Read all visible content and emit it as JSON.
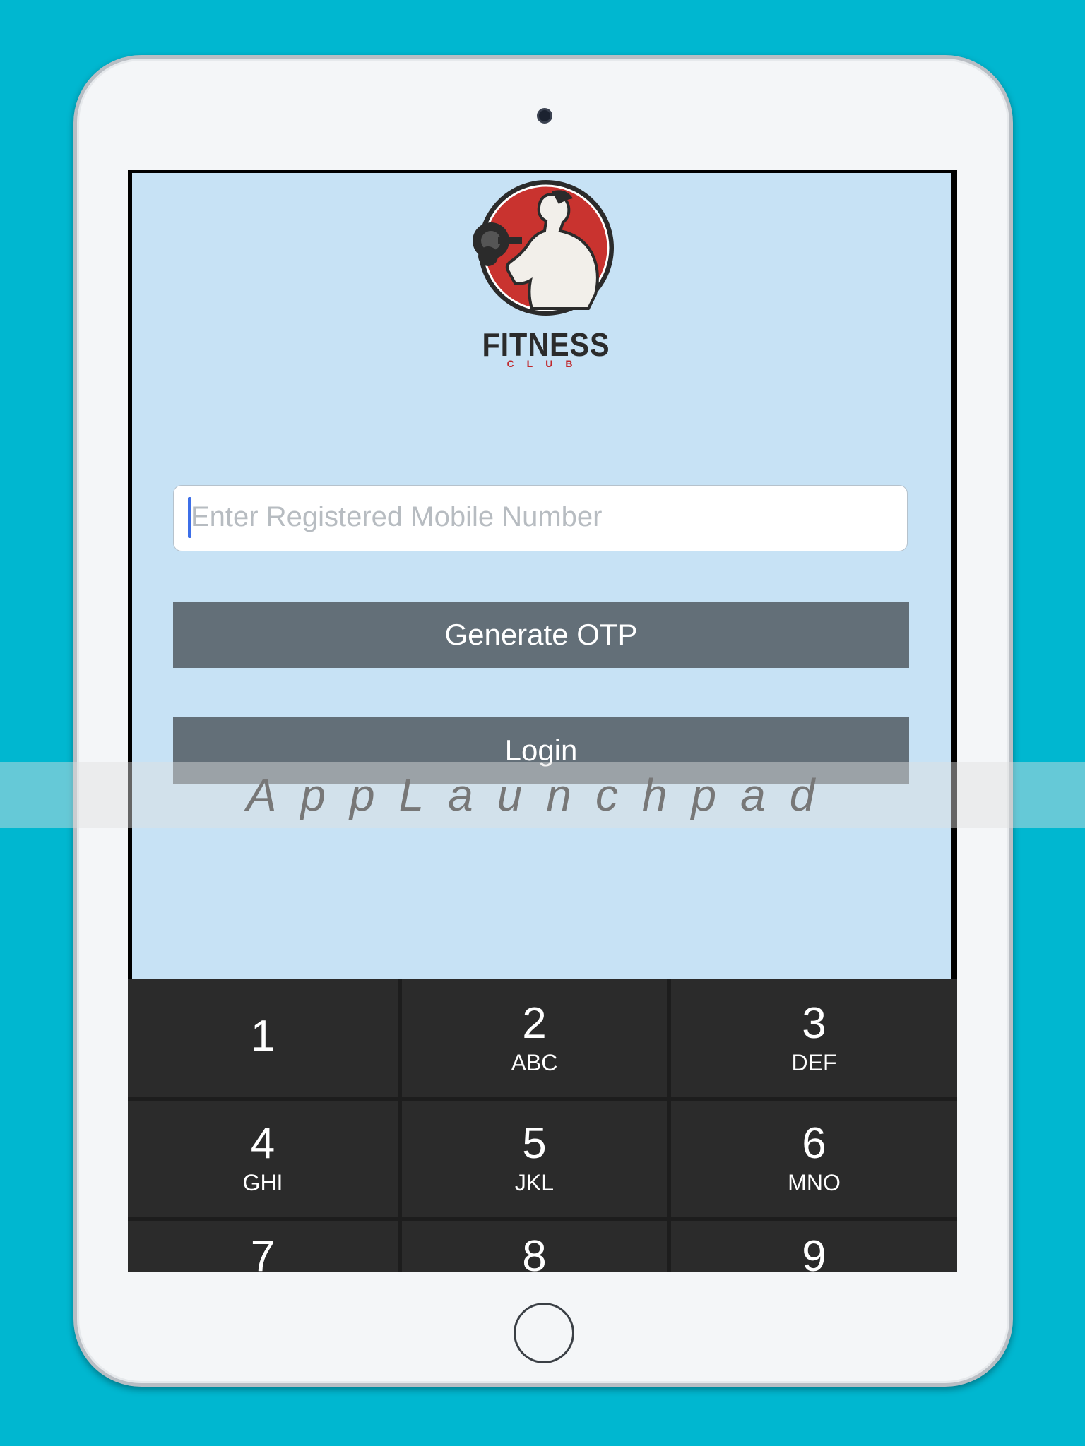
{
  "app": {
    "logo": {
      "title": "FITNESS",
      "subtitle": "CLUB"
    },
    "mobile_input": {
      "placeholder": "Enter Registered Mobile Number",
      "value": ""
    },
    "buttons": {
      "generate_otp": "Generate OTP",
      "login": "Login"
    }
  },
  "keypad": {
    "keys": [
      {
        "number": "1",
        "letters": ""
      },
      {
        "number": "2",
        "letters": "ABC"
      },
      {
        "number": "3",
        "letters": "DEF"
      },
      {
        "number": "4",
        "letters": "GHI"
      },
      {
        "number": "5",
        "letters": "JKL"
      },
      {
        "number": "6",
        "letters": "MNO"
      },
      {
        "number": "7",
        "letters": ""
      },
      {
        "number": "8",
        "letters": ""
      },
      {
        "number": "9",
        "letters": ""
      }
    ]
  },
  "watermark": {
    "text": "AppLaunchpad"
  },
  "colors": {
    "background": "#00b7d0",
    "app_background": "#c7e2f5",
    "button": "#636f78",
    "keypad": "#2b2b2b",
    "caret": "#3d6fe8"
  }
}
